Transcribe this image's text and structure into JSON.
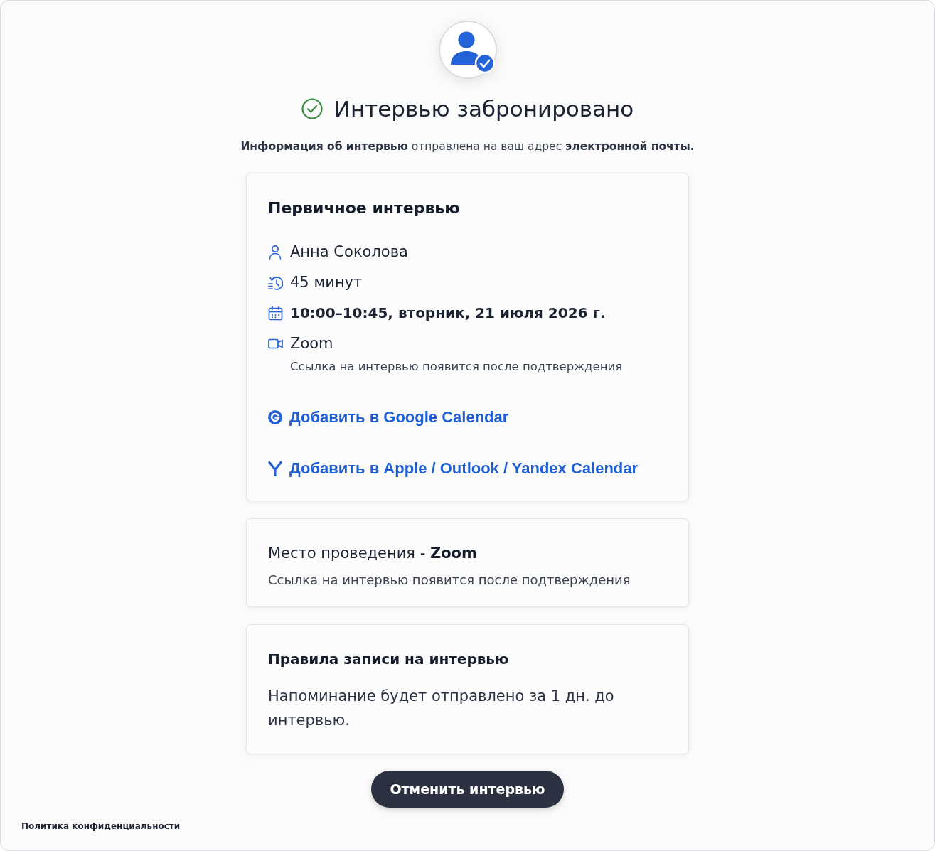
{
  "header": {
    "title": "Интервью забронировано",
    "subtitle": "**Информация об интервью** отправлена на ваш адрес **электронной почты.**"
  },
  "interview_card": {
    "title": "Первичное интервью",
    "details": [
      {
        "kind": "person",
        "text": "Анна Соколова"
      },
      {
        "kind": "duration",
        "text": "45 минут"
      },
      {
        "kind": "datetime",
        "text": "10:00–10:45, вторник, 21 июля 2026 г."
      },
      {
        "kind": "location",
        "text": "Zoom",
        "note": "Ссылка на интервью появится после подтверждения"
      }
    ],
    "calendar_links": [
      {
        "kind": "google",
        "label": "Добавить в Google Calendar"
      },
      {
        "kind": "other",
        "label": "Добавить в Apple / Outlook / Yandex Calendar"
      }
    ]
  },
  "location_card": {
    "text": "Место проведения - **Zoom**",
    "note": "Ссылка на интервью появится после подтверждения"
  },
  "rules_card": {
    "title": "Правила записи на интервью",
    "text": "Напоминание будет отправлено за 1 дн. до интервью."
  },
  "cancel_button": "Отменить интервью",
  "footer": {
    "privacy_link": "Политика конфиденциальности"
  }
}
